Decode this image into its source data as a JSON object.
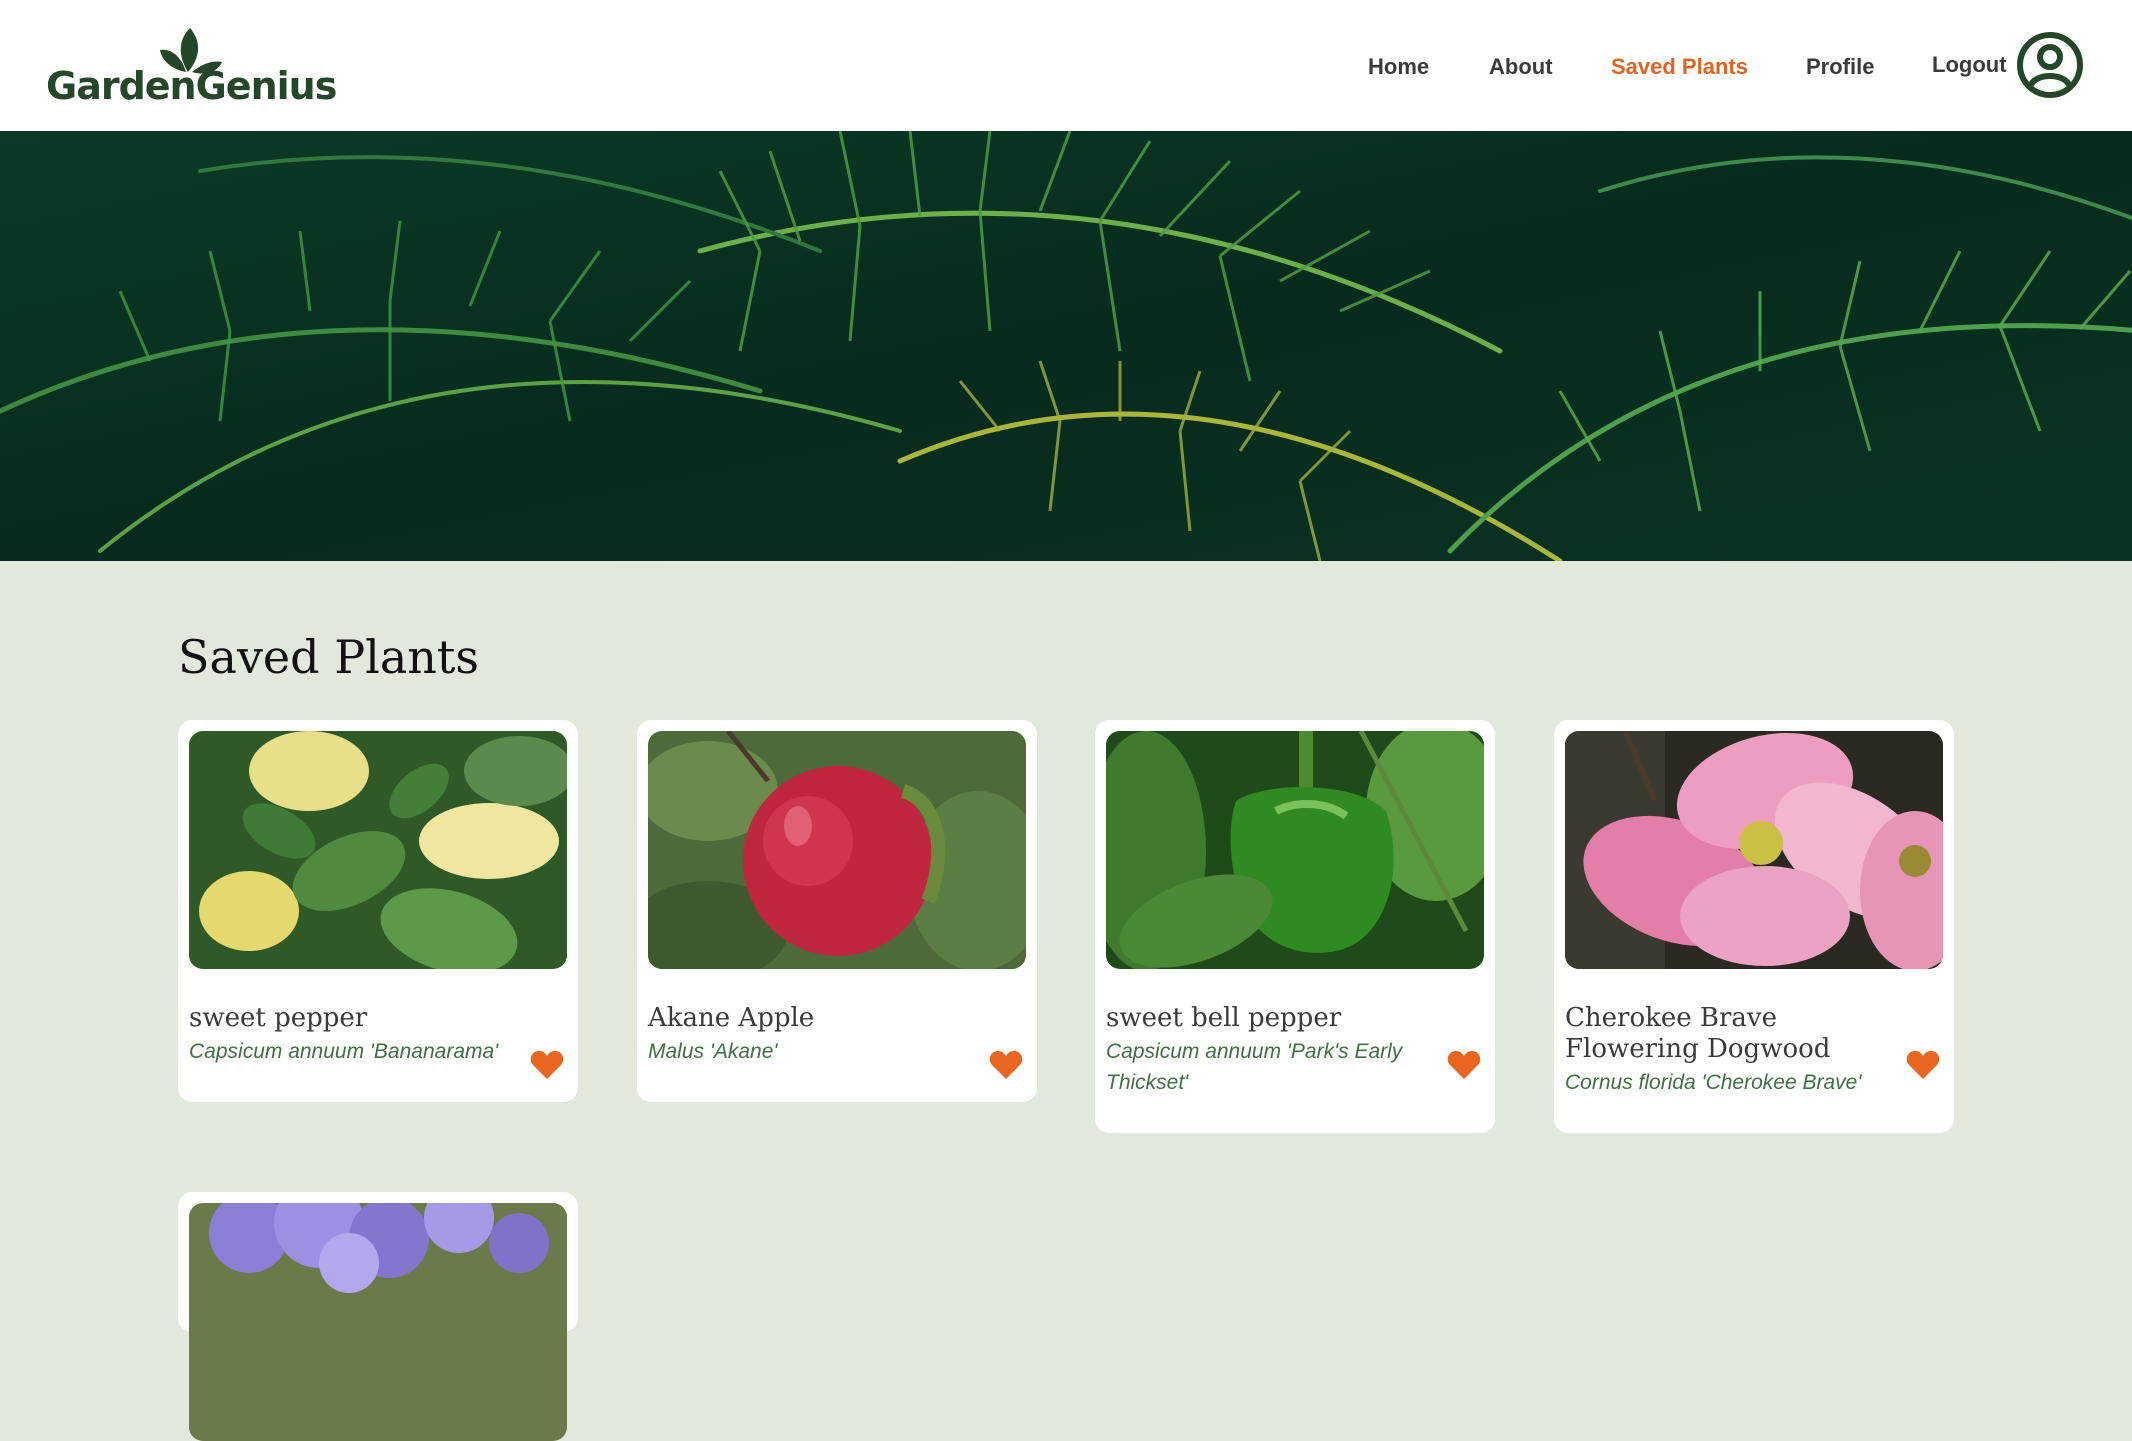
{
  "brand": {
    "name_part1": "Garden",
    "name_part2": "Genius",
    "logo_color": "#24472a"
  },
  "nav": {
    "items": [
      {
        "label": "Home",
        "active": false
      },
      {
        "label": "About",
        "active": false
      },
      {
        "label": "Saved Plants",
        "active": true
      },
      {
        "label": "Profile",
        "active": false
      },
      {
        "label": "Logout",
        "active": false
      }
    ],
    "active_color": "#e2621f",
    "avatar_icon": "user-circle-icon"
  },
  "hero": {
    "image_subject": "palm-fronds-photo"
  },
  "saved": {
    "title": "Saved Plants",
    "favorite_icon": "heart-icon",
    "favorite_color": "#e8661f",
    "plants": [
      {
        "common_name": "sweet pepper",
        "scientific_name": "Capsicum annuum 'Bananarama'",
        "photo": "yellow-pepper-plant-photo",
        "saved": true
      },
      {
        "common_name": "Akane Apple",
        "scientific_name": "Malus 'Akane'",
        "photo": "red-apple-photo",
        "saved": true
      },
      {
        "common_name": "sweet bell pepper",
        "scientific_name": "Capsicum annuum 'Park's Early Thickset'",
        "photo": "green-bell-pepper-photo",
        "saved": true
      },
      {
        "common_name": "Cherokee Brave Flowering Dogwood",
        "scientific_name": "Cornus florida 'Cherokee Brave'",
        "photo": "pink-dogwood-flower-photo",
        "saved": true
      },
      {
        "common_name": "",
        "scientific_name": "",
        "photo": "purple-ageratum-flower-photo",
        "saved": true
      }
    ]
  }
}
